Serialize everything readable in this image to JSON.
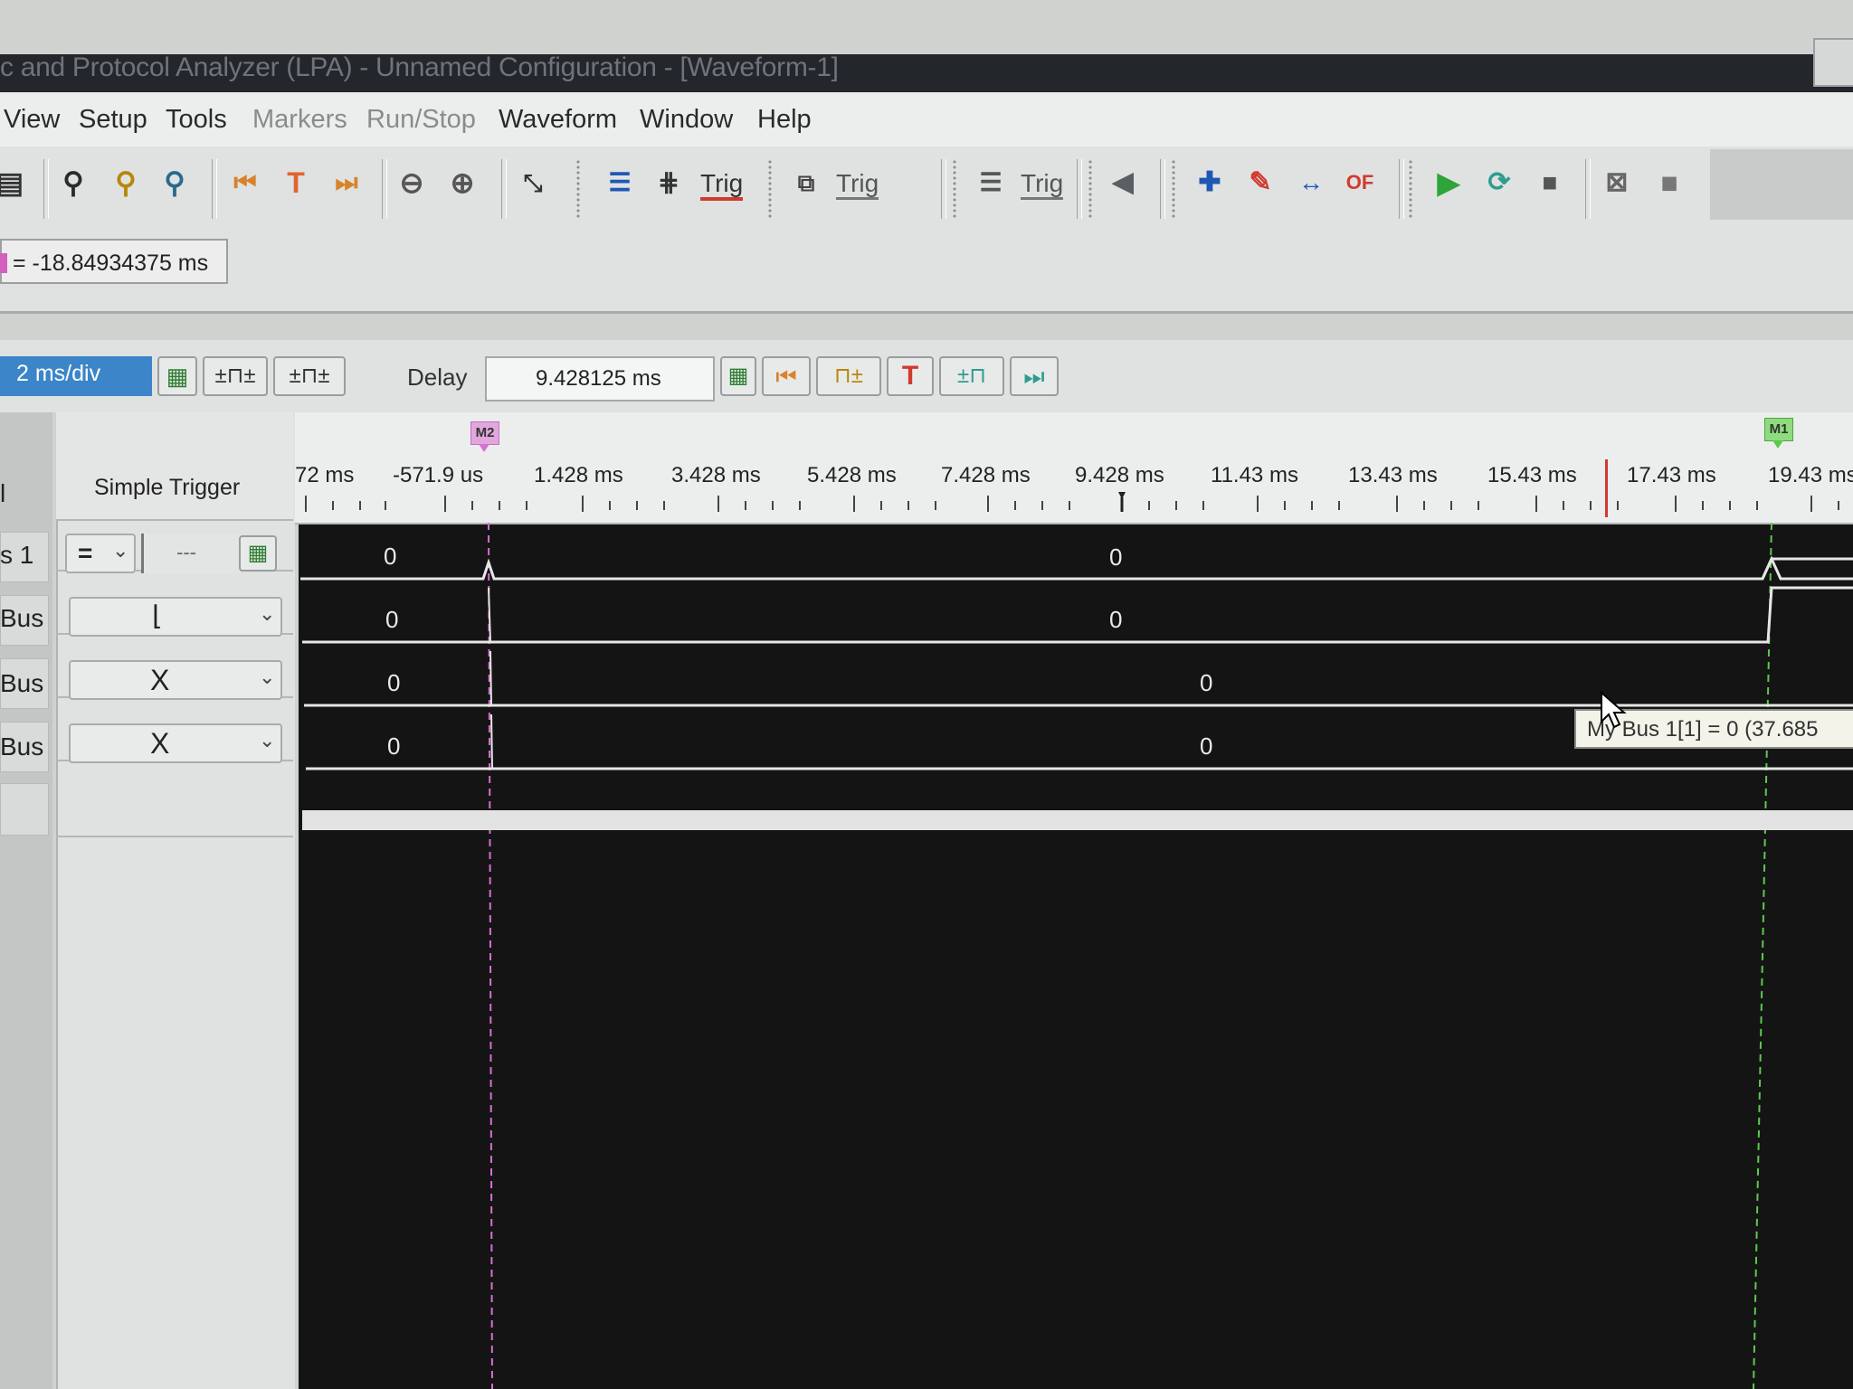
{
  "window": {
    "title": "c and Protocol Analyzer (LPA) - Unnamed Configuration - [Waveform-1]"
  },
  "menu": [
    {
      "label": "View",
      "disabled": false
    },
    {
      "label": "Setup",
      "disabled": false
    },
    {
      "label": "Tools",
      "disabled": false
    },
    {
      "label": "Markers",
      "disabled": true
    },
    {
      "label": "Run/Stop",
      "disabled": true
    },
    {
      "label": "Waveform",
      "disabled": false
    },
    {
      "label": "Window",
      "disabled": false
    },
    {
      "label": "Help",
      "disabled": false
    }
  ],
  "toolbar": {
    "trig_labels": [
      "Trig",
      "Trig",
      "Trig"
    ],
    "edit_marker_label": "OF"
  },
  "marker_delta": {
    "text": "= -18.84934375 ms",
    "color": "#d45fbf"
  },
  "timebase": {
    "scale": "2 ms/div",
    "delay_label": "Delay",
    "delay_value": "9.428125 ms"
  },
  "trigger_panel": {
    "title": "Simple Trigger",
    "operator": "=",
    "value_placeholder": "---"
  },
  "signals": [
    {
      "label": "s 1",
      "trigger": "=",
      "values": [
        "0",
        "0"
      ]
    },
    {
      "label": "Bus",
      "trigger": "falling-edge",
      "values": [
        "0",
        "0"
      ]
    },
    {
      "label": "Bus",
      "trigger": "X",
      "values": [
        "0",
        "0"
      ]
    },
    {
      "label": "Bus",
      "trigger": "X",
      "values": [
        "0",
        "0"
      ]
    }
  ],
  "left_header_label": "l",
  "ruler": {
    "ticks": [
      "72 ms",
      "-571.9 us",
      "1.428 ms",
      "3.428 ms",
      "5.428 ms",
      "7.428 ms",
      "9.428 ms",
      "11.43 ms",
      "13.43 ms",
      "15.43 ms",
      "17.43 ms",
      "19.43 ms"
    ]
  },
  "markers": [
    {
      "name": "M2",
      "color": "#d86fd2"
    },
    {
      "name": "M1",
      "color": "#5cc94e"
    }
  ],
  "tooltip": {
    "text": "My Bus 1[1] = 0 (37.685"
  },
  "colors": {
    "trigger_line": "#d23a2f",
    "waveform_bg": "#141414",
    "selection_blue": "#3b85c8"
  }
}
